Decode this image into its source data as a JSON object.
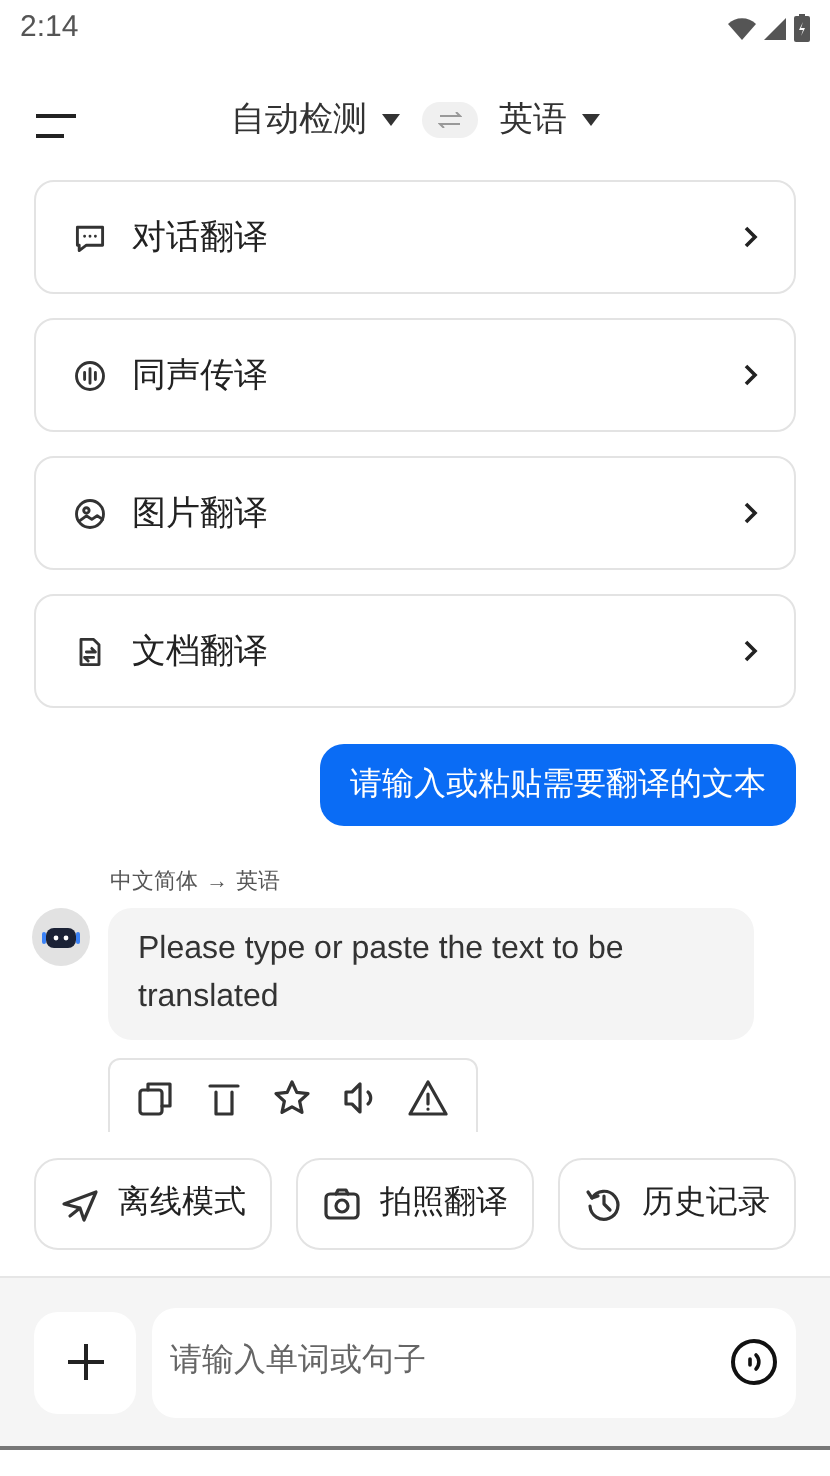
{
  "status_bar": {
    "time": "2:14"
  },
  "header": {
    "source_language": "自动检测",
    "target_language": "英语"
  },
  "features": [
    {
      "kind": "chat",
      "label": "对话翻译"
    },
    {
      "kind": "simultaneous",
      "label": "同声传译"
    },
    {
      "kind": "image",
      "label": "图片翻译"
    },
    {
      "kind": "document",
      "label": "文档翻译"
    }
  ],
  "messages": [
    {
      "kind": "user",
      "text": "请输入或粘贴需要翻译的文本"
    },
    {
      "kind": "bot",
      "source_language": "中文简体",
      "arrow": "→",
      "target_language": "英语",
      "text": "Please type or paste the text to be translated"
    }
  ],
  "quick_actions": [
    {
      "kind": "offline",
      "label": "离线模式"
    },
    {
      "kind": "camera",
      "label": "拍照翻译"
    },
    {
      "kind": "history",
      "label": "历史记录"
    }
  ],
  "input": {
    "placeholder": "请输入单词或句子"
  }
}
